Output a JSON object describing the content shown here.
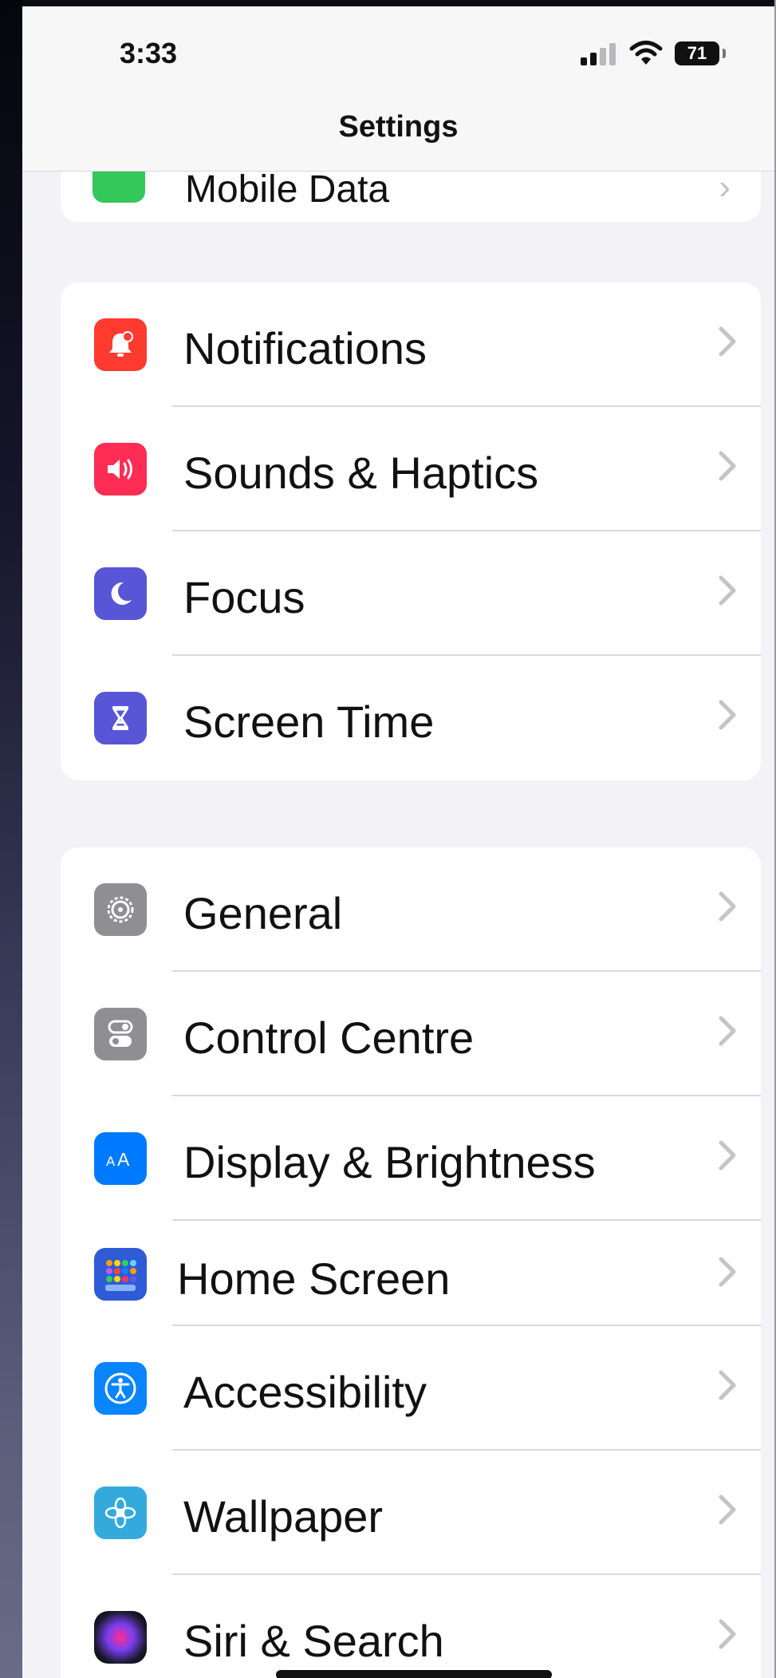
{
  "status_bar": {
    "time": "3:33",
    "battery": "71"
  },
  "header": {
    "title": "Settings"
  },
  "partial_row": {
    "label": "Mobile Data",
    "icon": "antenna-icon",
    "color": "#34c759"
  },
  "groups": [
    {
      "items": [
        {
          "label": "Notifications",
          "icon": "bell-badge-icon",
          "color": "#ff3b30"
        },
        {
          "label": "Sounds & Haptics",
          "icon": "speaker-icon",
          "color": "#ff2d55"
        },
        {
          "label": "Focus",
          "icon": "moon-icon",
          "color": "#5856d6"
        },
        {
          "label": "Screen Time",
          "icon": "hourglass-icon",
          "color": "#5856d6"
        }
      ]
    },
    {
      "items": [
        {
          "label": "General",
          "icon": "gear-icon",
          "color": "#8e8e93"
        },
        {
          "label": "Control Centre",
          "icon": "toggles-icon",
          "color": "#8e8e93"
        },
        {
          "label": "Display & Brightness",
          "icon": "text-size-icon",
          "color": "#007aff"
        },
        {
          "label": "Home Screen",
          "icon": "app-grid-icon",
          "color": "#2f5bd6"
        },
        {
          "label": "Accessibility",
          "icon": "accessibility-icon",
          "color": "#0a84ff"
        },
        {
          "label": "Wallpaper",
          "icon": "flower-icon",
          "color": "#34aadc"
        },
        {
          "label": "Siri & Search",
          "icon": "siri-icon",
          "color": "#222222"
        }
      ]
    }
  ]
}
